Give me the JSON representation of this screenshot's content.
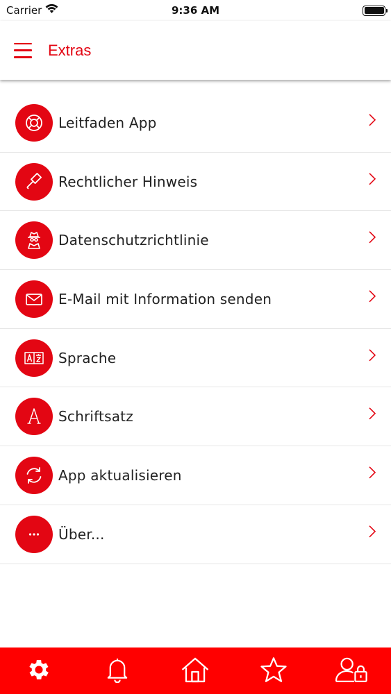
{
  "status_bar": {
    "carrier": "Carrier",
    "time": "9:36 AM",
    "icons": [
      "wifi-icon",
      "battery-icon"
    ]
  },
  "header": {
    "title": "Extras",
    "menu_icon": "hamburger-menu-icon"
  },
  "menu_items": [
    {
      "label": "Leitfaden App",
      "icon": "lifebuoy-icon"
    },
    {
      "label": "Rechtlicher Hinweis",
      "icon": "gavel-icon"
    },
    {
      "label": "Datenschutzrichtlinie",
      "icon": "spy-icon"
    },
    {
      "label": "E-Mail mit Information senden",
      "icon": "envelope-icon"
    },
    {
      "label": "Sprache",
      "icon": "translate-icon"
    },
    {
      "label": "Schriftsatz",
      "icon": "font-icon"
    },
    {
      "label": "App aktualisieren",
      "icon": "refresh-icon"
    },
    {
      "label": "Über...",
      "icon": "more-dots-icon"
    }
  ],
  "tab_bar": {
    "tabs": [
      "settings-tab",
      "notifications-tab",
      "home-tab",
      "favorites-tab",
      "account-lock-tab"
    ],
    "active": "settings-tab"
  },
  "colors": {
    "accent": "#e30613",
    "tab_bar_bg": "#ff0000"
  }
}
